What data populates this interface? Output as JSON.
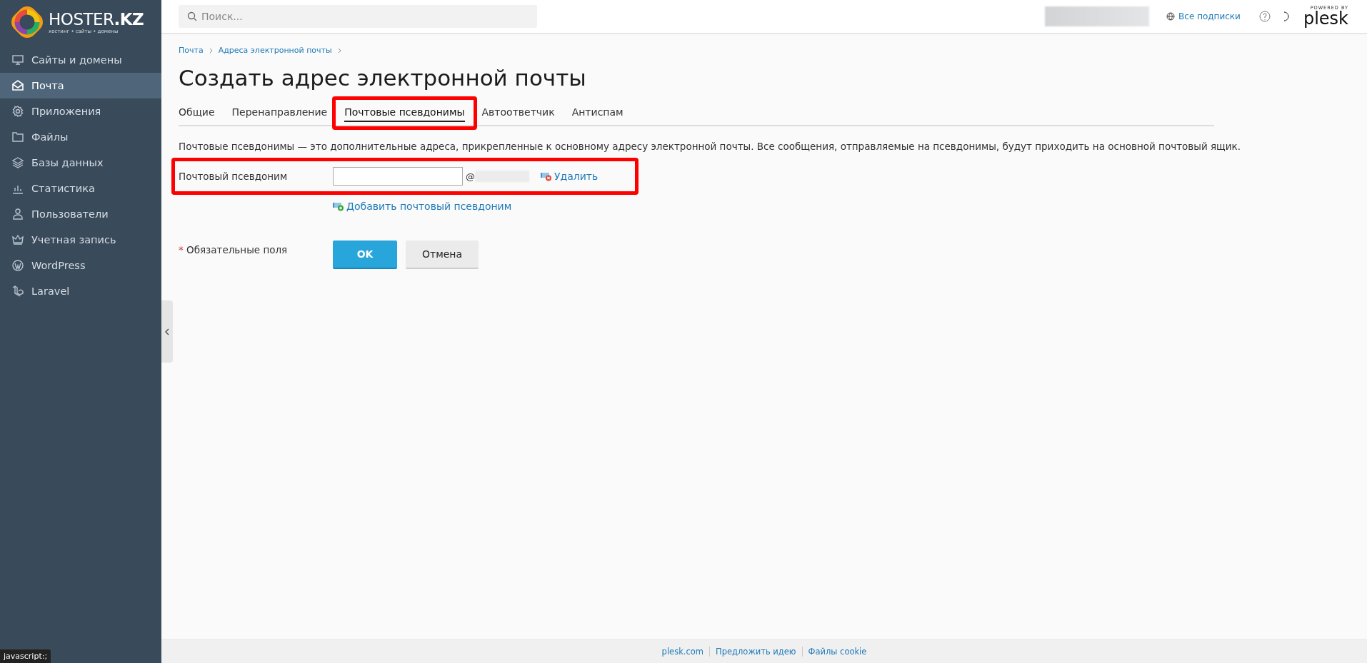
{
  "brand": {
    "name": "HOSTER",
    "suffix": ".KZ",
    "tagline": "хостинг • сайты • домены"
  },
  "sidebar": {
    "items": [
      {
        "label": "Сайты и домены",
        "selected": false
      },
      {
        "label": "Почта",
        "selected": true
      },
      {
        "label": "Приложения",
        "selected": false
      },
      {
        "label": "Файлы",
        "selected": false
      },
      {
        "label": "Базы данных",
        "selected": false
      },
      {
        "label": "Статистика",
        "selected": false
      },
      {
        "label": "Пользователи",
        "selected": false
      },
      {
        "label": "Учетная запись",
        "selected": false
      },
      {
        "label": "WordPress",
        "selected": false
      },
      {
        "label": "Laravel",
        "selected": false
      }
    ]
  },
  "header": {
    "search": {
      "placeholder": "Поиск..."
    },
    "subscriptions": "Все подписки",
    "powered_by": "POWERED BY",
    "plesk": "plesk"
  },
  "breadcrumbs": [
    "Почта",
    "Адреса электронной почты"
  ],
  "title": "Создать адрес электронной почты",
  "tabs": [
    {
      "label": "Общие",
      "selected": false,
      "highlighted": false
    },
    {
      "label": "Перенаправление",
      "selected": false,
      "highlighted": false
    },
    {
      "label": "Почтовые псевдонимы",
      "selected": true,
      "highlighted": true
    },
    {
      "label": "Автоответчик",
      "selected": false,
      "highlighted": false
    },
    {
      "label": "Антиспам",
      "selected": false,
      "highlighted": false
    }
  ],
  "description": "Почтовые псевдонимы — это дополнительные адреса, прикрепленные к основному адресу электронной почты. Все сообщения, отправляемые на псевдонимы, будут приходить на основной почтовый ящик.",
  "alias_row": {
    "label": "Почтовый псевдоним",
    "at": "@",
    "delete": "Удалить",
    "highlighted": true
  },
  "add_alias": "Добавить почтовый псевдоним",
  "required": {
    "mark": "*",
    "label": "Обязательные поля"
  },
  "buttons": [
    {
      "label": "OK",
      "kind": "primary"
    },
    {
      "label": "Отмена",
      "kind": "secondary"
    }
  ],
  "footer_links": [
    "plesk.com",
    "Предложить идею",
    "Файлы cookie"
  ],
  "status_bar": "javascript:;"
}
